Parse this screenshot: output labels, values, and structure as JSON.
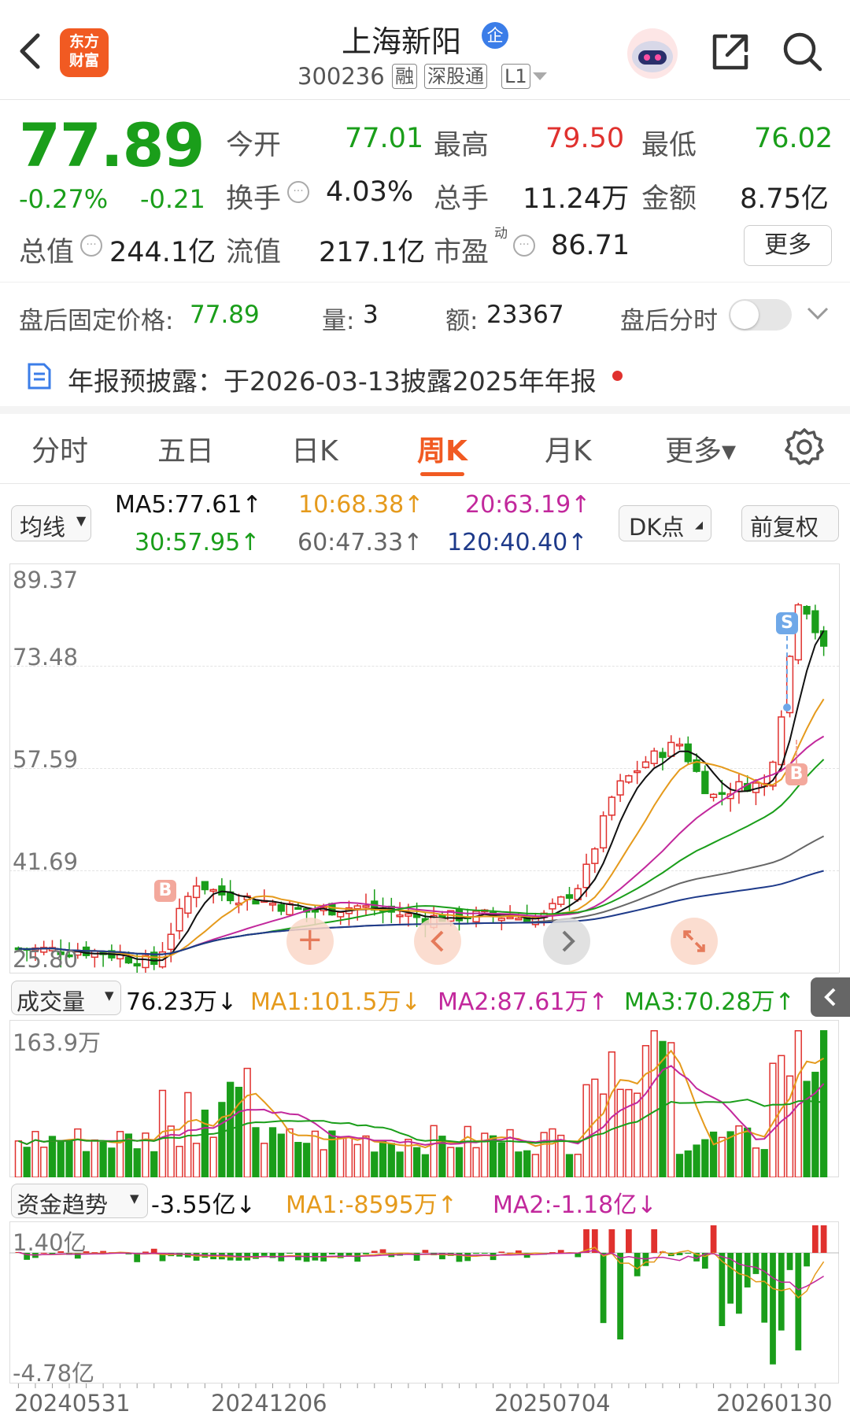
{
  "header": {
    "title": "上海新阳",
    "title_badge": "企",
    "logo_text_line1": "东方",
    "logo_text_line2": "财富",
    "code": "300236",
    "tag1": "融",
    "tag2": "深股通",
    "tag3": "L1"
  },
  "quote": {
    "price": "77.89",
    "change_pct": "-0.27%",
    "change": "-0.21",
    "stats": [
      {
        "label": "今开",
        "value": "77.01"
      },
      {
        "label": "最高",
        "value": "79.50"
      },
      {
        "label": "最低",
        "value": "76.02"
      },
      {
        "label": "换手",
        "value": "4.03%"
      },
      {
        "label": "总手",
        "value": "11.24万"
      },
      {
        "label": "金额",
        "value": "8.75亿"
      },
      {
        "label": "总值",
        "value": "244.1亿"
      },
      {
        "label": "流值",
        "value": "217.1亿"
      },
      {
        "label": "市盈",
        "value": "86.71",
        "sup": "动"
      }
    ],
    "more_button": "更多"
  },
  "after_hours": {
    "price_label": "盘后固定价格:",
    "price_value": "77.89",
    "volume_label": "量:",
    "volume_value": "3",
    "amount_label": "额:",
    "amount_value": "23367",
    "toggle_label": "盘后分时"
  },
  "notice": {
    "text": "年报预披露：于2026-03-13披露2025年年报"
  },
  "tabs": [
    {
      "label": "分时",
      "active": false
    },
    {
      "label": "五日",
      "active": false
    },
    {
      "label": "日K",
      "active": false
    },
    {
      "label": "周K",
      "active": true
    },
    {
      "label": "月K",
      "active": false
    },
    {
      "label": "更多▾",
      "active": false
    }
  ],
  "ma_legend": {
    "selector": "均线",
    "ma5": "MA5:77.61↑",
    "ma10": "10:68.38↑",
    "ma20": "20:63.19↑",
    "ma30": "30:57.95↑",
    "ma60": "60:47.33↑",
    "ma120": "120:40.40↑",
    "dk_button": "DK点",
    "adjust_button": "前复权"
  },
  "main_chart": {
    "y_labels": [
      "89.37",
      "73.48",
      "57.59",
      "41.69",
      "25.80"
    ],
    "marker_b": "B",
    "marker_s": "S"
  },
  "volume": {
    "selector": "成交量",
    "value": "76.23万↓",
    "ma1": "MA1:101.5万↓",
    "ma2": "MA2:87.61万↑",
    "ma3": "MA3:70.28万↑",
    "y_top": "163.9万"
  },
  "fund_flow": {
    "selector": "资金趋势",
    "value": "-3.55亿↓",
    "ma1": "MA1:-8595万↑",
    "ma2": "MA2:-1.18亿↓",
    "y_top": "1.40亿",
    "y_bottom": "-4.78亿"
  },
  "x_axis": [
    "20240531",
    "20241206",
    "20250704",
    "20260130"
  ],
  "colors": {
    "up": "#e0312e",
    "down": "#1a9e1a",
    "accent": "#f15a22",
    "ma5": "#111111",
    "ma10": "#e59a1c",
    "ma20": "#c2289c",
    "ma30": "#1a9e1a",
    "ma60": "#666666",
    "ma120": "#1e3a8a"
  }
}
